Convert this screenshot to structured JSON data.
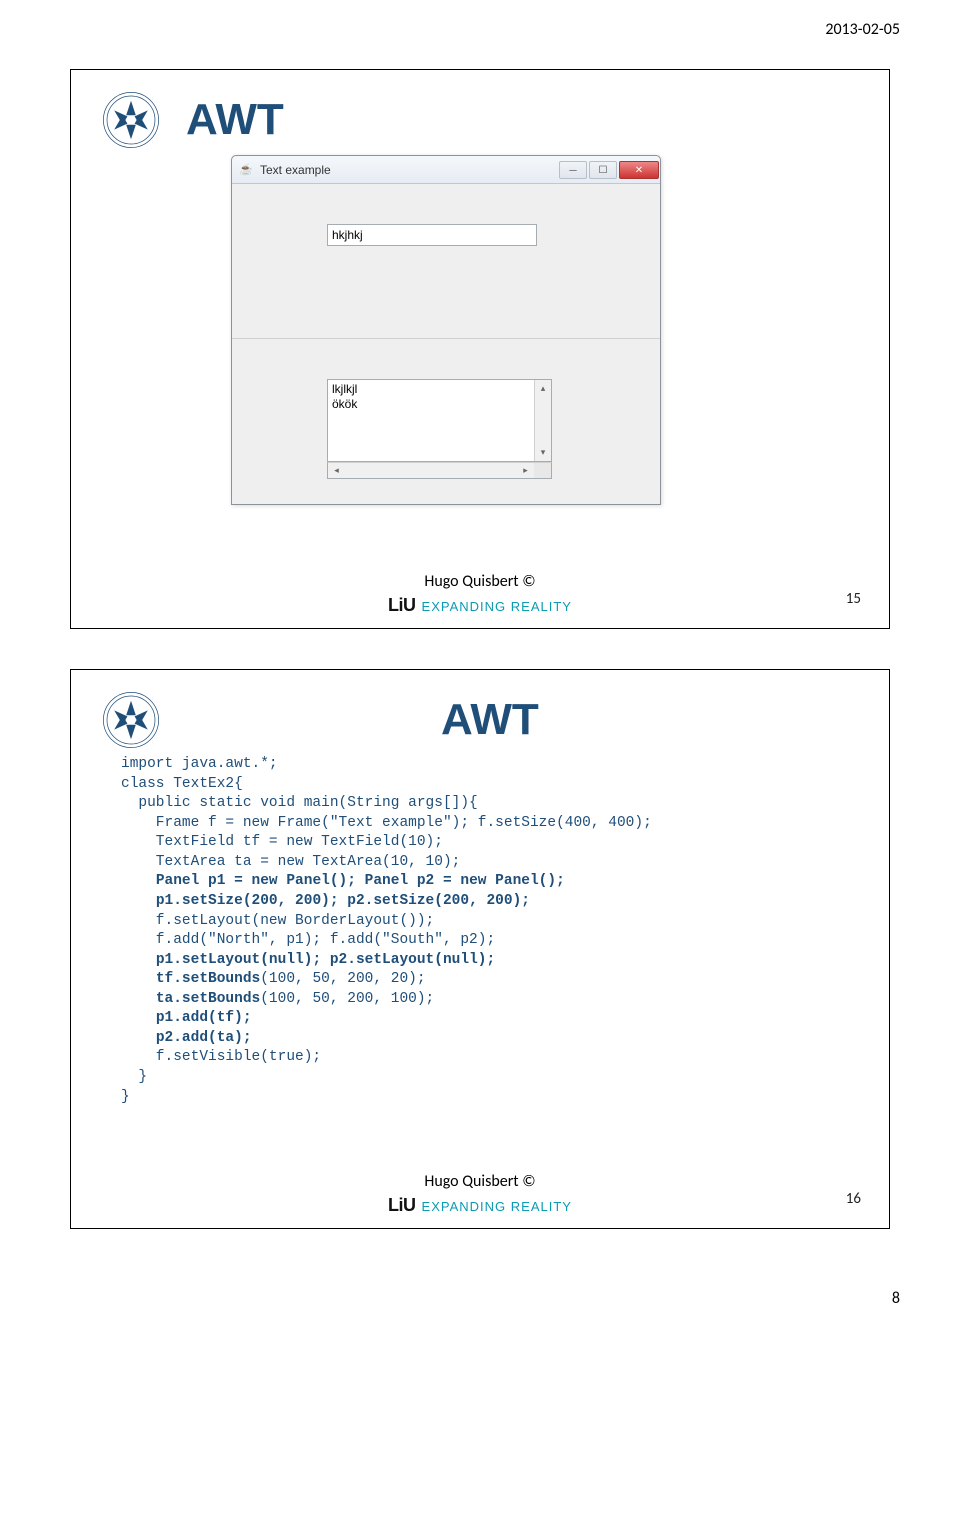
{
  "header_date": "2013-02-05",
  "page_number": "8",
  "slide1": {
    "title": "AWT",
    "window": {
      "title": "Text example",
      "textfield_value": "hkjhkj",
      "textarea_value": "lkjlkjl\nökök"
    },
    "author": "Hugo Quisbert ©",
    "brand": "LiU",
    "brand_tag": "EXPANDING REALITY",
    "number": "15"
  },
  "slide2": {
    "title": "AWT",
    "code": "import java.awt.*;\nclass TextEx2{\n  public static void main(String args[]){\n    Frame f = new Frame(\"Text example\"); f.setSize(400, 400);\n    TextField tf = new TextField(10);\n    TextArea ta = new TextArea(10, 10);\n    Panel p1 = new Panel(); Panel p2 = new Panel();\n    p1.setSize(200, 200); p2.setSize(200, 200);\n    f.setLayout(new BorderLayout());\n    f.add(\"North\", p1); f.add(\"South\", p2);\n    p1.setLayout(null); p2.setLayout(null);\n    tf.setBounds(100, 50, 200, 20);\n    ta.setBounds(100, 50, 200, 100);\n    p1.add(tf);\n    p2.add(ta);\n    f.setVisible(true);\n  }\n}",
    "author": "Hugo Quisbert ©",
    "brand": "LiU",
    "brand_tag": "EXPANDING REALITY",
    "number": "16"
  }
}
